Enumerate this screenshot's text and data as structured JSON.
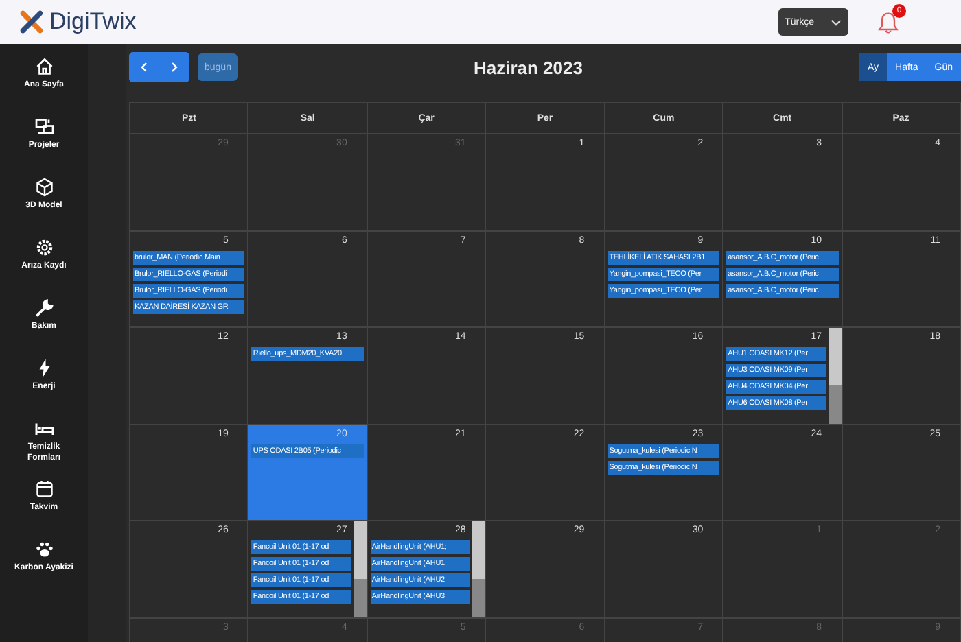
{
  "brand": {
    "name": "DigiTwix"
  },
  "header": {
    "language": "Türkçe",
    "notifications": "0"
  },
  "sidebar": {
    "items": [
      {
        "label": "Ana Sayfa",
        "selected": false
      },
      {
        "label": "Projeler",
        "selected": false
      },
      {
        "label": "3D Model",
        "selected": false
      },
      {
        "label": "Arıza Kaydı",
        "selected": false
      },
      {
        "label": "Bakım",
        "selected": false
      },
      {
        "label": "Enerji",
        "selected": false
      },
      {
        "label": "Temizlik Formları",
        "selected": false
      },
      {
        "label": "Takvim",
        "selected": false
      },
      {
        "label": "Karbon Ayakizi",
        "selected": false
      }
    ]
  },
  "toolbar": {
    "today": "bugün",
    "title": "Haziran 2023",
    "views": [
      {
        "label": "Ay",
        "selected": true
      },
      {
        "label": "Hafta",
        "selected": false
      },
      {
        "label": "Gün",
        "selected": false
      }
    ]
  },
  "calendar": {
    "weekdays": [
      "Pzt",
      "Sal",
      "Çar",
      "Per",
      "Cum",
      "Cmt",
      "Paz"
    ],
    "weeks": [
      [
        {
          "day": "29",
          "muted": true
        },
        {
          "day": "30",
          "muted": true
        },
        {
          "day": "31",
          "muted": true
        },
        {
          "day": "1",
          "muted": false
        },
        {
          "day": "2",
          "muted": false
        },
        {
          "day": "3",
          "muted": false
        },
        {
          "day": "4",
          "muted": false
        }
      ],
      [
        {
          "day": "5",
          "muted": false,
          "events": [
            "brulor_MAN (Periodic Main",
            "Brulor_RIELLO-GAS (Periodi",
            "Brulor_RIELLO-GAS (Periodi",
            "KAZAN DAİRESİ KAZAN GR"
          ]
        },
        {
          "day": "6",
          "muted": false
        },
        {
          "day": "7",
          "muted": false
        },
        {
          "day": "8",
          "muted": false
        },
        {
          "day": "9",
          "muted": false,
          "events": [
            "TEHLİKELİ ATIK SAHASI 2B1",
            "Yangin_pompasi_TECO (Per",
            "Yangin_pompasi_TECO (Per"
          ]
        },
        {
          "day": "10",
          "muted": false,
          "events": [
            "asansor_A.B.C_motor (Peric",
            "asansor_A.B.C_motor (Peric",
            "asansor_A.B.C_motor (Peric"
          ]
        },
        {
          "day": "11",
          "muted": false
        }
      ],
      [
        {
          "day": "12",
          "muted": false
        },
        {
          "day": "13",
          "muted": false,
          "events": [
            "Riello_ups_MDM20_KVA20"
          ]
        },
        {
          "day": "14",
          "muted": false
        },
        {
          "day": "15",
          "muted": false
        },
        {
          "day": "16",
          "muted": false
        },
        {
          "day": "17",
          "muted": false,
          "scrollable": true,
          "events": [
            "AHU1 ODASI MK12 (Per",
            "AHU3 ODASI MK09 (Per",
            "AHU4 ODASI MK04 (Per",
            "AHU6 ODASI MK08 (Per"
          ]
        },
        {
          "day": "18",
          "muted": false
        }
      ],
      [
        {
          "day": "19",
          "muted": false
        },
        {
          "day": "20",
          "muted": false,
          "selected": true,
          "events": [
            "UPS ODASI 2B05 (Periodic"
          ]
        },
        {
          "day": "21",
          "muted": false
        },
        {
          "day": "22",
          "muted": false
        },
        {
          "day": "23",
          "muted": false,
          "events": [
            "Sogutma_kulesi (Periodic N",
            "Sogutma_kulesi (Periodic N"
          ]
        },
        {
          "day": "24",
          "muted": false
        },
        {
          "day": "25",
          "muted": false
        }
      ],
      [
        {
          "day": "26",
          "muted": false
        },
        {
          "day": "27",
          "muted": false,
          "scrollable": true,
          "events": [
            "Fancoil Unit 01 (1-17 od",
            "Fancoil Unit 01 (1-17 od",
            "Fancoil Unit 01 (1-17 od",
            "Fancoil Unit 01 (1-17 od"
          ]
        },
        {
          "day": "28",
          "muted": false,
          "scrollable": true,
          "events": [
            "AirHandlingUnit (AHU1;",
            "AirHandlingUnit (AHU1",
            "AirHandlingUnit (AHU2",
            "AirHandlingUnit (AHU3"
          ]
        },
        {
          "day": "29",
          "muted": false
        },
        {
          "day": "30",
          "muted": false
        },
        {
          "day": "1",
          "muted": true
        },
        {
          "day": "2",
          "muted": true
        }
      ],
      [
        {
          "day": "3",
          "muted": true
        },
        {
          "day": "4",
          "muted": true
        },
        {
          "day": "5",
          "muted": true
        },
        {
          "day": "6",
          "muted": true
        },
        {
          "day": "7",
          "muted": true
        },
        {
          "day": "8",
          "muted": true
        },
        {
          "day": "9",
          "muted": true
        }
      ]
    ]
  }
}
